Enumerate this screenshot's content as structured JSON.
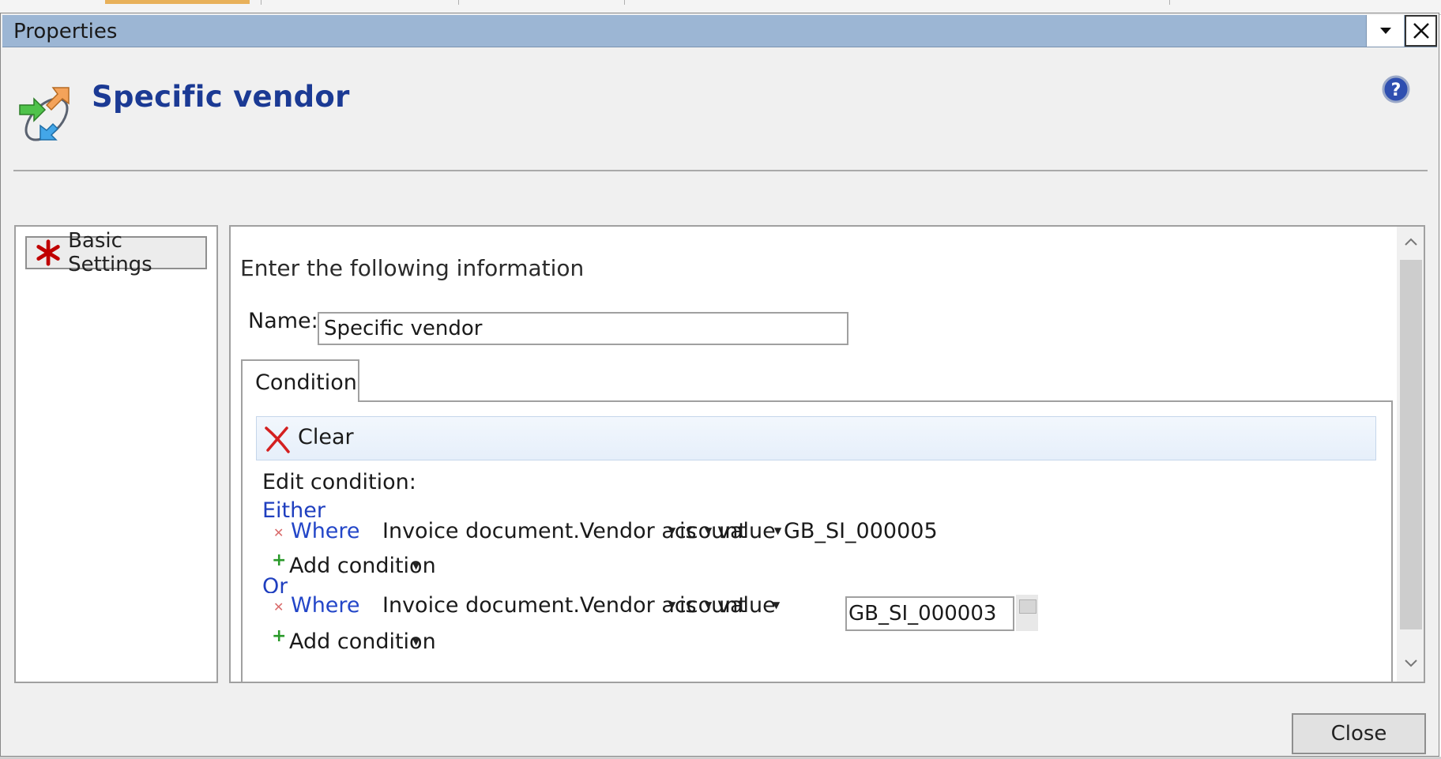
{
  "dialog": {
    "title": "Properties",
    "header_title": "Specific vendor",
    "icons": {
      "header": "process-arrows-icon",
      "help": "help-icon",
      "dropdown": "caret-down-icon",
      "close": "close-icon"
    }
  },
  "nav": {
    "items": [
      {
        "label": "Basic Settings",
        "icon": "required-star-icon"
      }
    ]
  },
  "form": {
    "instruction": "Enter the following information",
    "name_label": "Name:",
    "name_value": "Specific vendor",
    "tabs": [
      {
        "label": "Condition",
        "selected": true
      }
    ]
  },
  "condition": {
    "clear_label": "Clear",
    "edit_label": "Edit condition:",
    "groups": [
      {
        "connector": "Either",
        "where_label": "Where",
        "field": "Invoice document.Vendor account",
        "operator": "is",
        "value_type": "value",
        "value": "GB_SI_000005",
        "add_label": "Add condition"
      },
      {
        "connector": "Or",
        "where_label": "Where",
        "field": "Invoice document.Vendor account",
        "operator": "is",
        "value_type": "value",
        "value": "GB_SI_000003",
        "add_label": "Add condition"
      }
    ]
  },
  "footer": {
    "close_label": "Close"
  },
  "colors": {
    "titlebar": "#9cb6d4",
    "header_title": "#1b3a94",
    "link": "#2346c8",
    "add_plus": "#2a9a2a",
    "remove_x": "#d96b6b",
    "required_star": "#c00000"
  }
}
